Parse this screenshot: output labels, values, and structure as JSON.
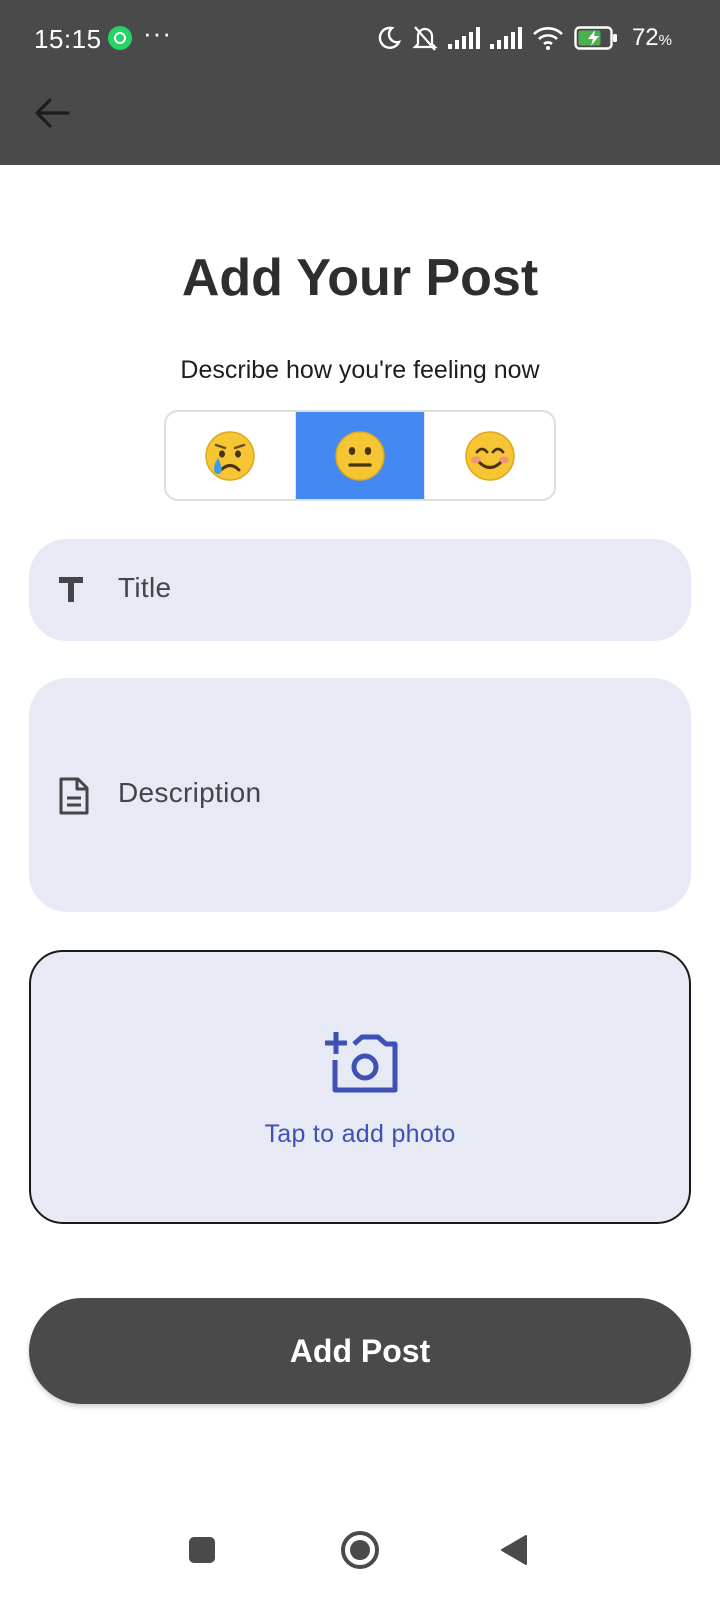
{
  "status_bar": {
    "time": "15:15",
    "more": "···",
    "battery_percent": "72",
    "battery_unit": "%",
    "icons": [
      "whatsapp-icon",
      "moon-icon",
      "bell-off-icon",
      "signal-icon",
      "signal-icon",
      "wifi-icon",
      "battery-charging-icon"
    ]
  },
  "app_bar": {
    "back_icon": "arrow-back-icon"
  },
  "page": {
    "title": "Add Your Post",
    "subtitle": "Describe how you're feeling now"
  },
  "mood_selector": {
    "options": [
      {
        "emoji": "😢",
        "name": "sad",
        "selected": false
      },
      {
        "emoji": "😐",
        "name": "neutral",
        "selected": true
      },
      {
        "emoji": "😊",
        "name": "happy",
        "selected": false
      }
    ],
    "selected_color": "#4488f2"
  },
  "form": {
    "title_field": {
      "label": "Title",
      "icon": "text-title-icon"
    },
    "description_field": {
      "label": "Description",
      "icon": "document-icon"
    },
    "photo": {
      "label": "Tap to add photo",
      "icon": "add-photo-camera-icon",
      "accent": "#3f51b5"
    },
    "submit_label": "Add Post"
  },
  "colors": {
    "app_bar": "#4a4a4a",
    "field_background": "#e7e9f5",
    "button": "#4a4a4a"
  },
  "nav_bar": {
    "icons": [
      "recents-square-icon",
      "home-circle-icon",
      "back-triangle-icon"
    ]
  }
}
